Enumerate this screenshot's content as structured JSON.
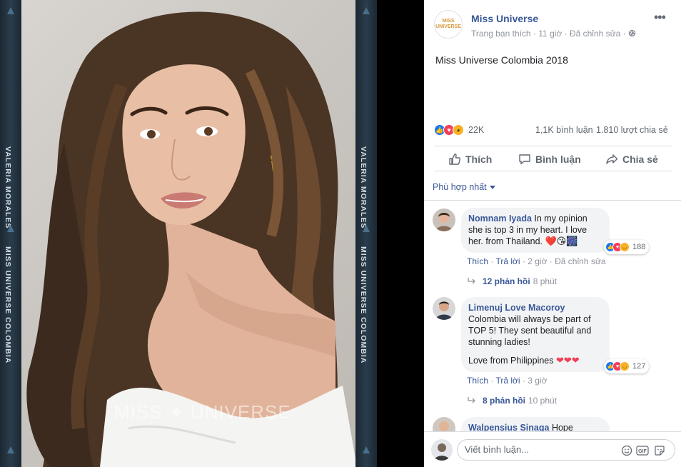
{
  "photo": {
    "left_strip_text_top": "VALERIA MORALES",
    "left_strip_text_bottom": "MISS UNIVERSE COLOMBIA",
    "right_strip_text_top": "VALERIA MORALES",
    "right_strip_text_bottom": "MISS UNIVERSE COLOMBIA",
    "watermark": "MISS ✦ UNIVERSE"
  },
  "post": {
    "page_logo_text": "MISS UNIVERSE",
    "page_name": "Miss Universe",
    "meta": "Trang bạn thích · 11 giờ · Đã chỉnh sửa ·",
    "text": "Miss Universe Colombia 2018",
    "reaction_count": "22K",
    "comments_count": "1,1K bình luận",
    "shares_count": "1.810 lượt chia sẻ"
  },
  "actions": {
    "like": "Thích",
    "comment": "Bình luận",
    "share": "Chia sẻ"
  },
  "sort_label": "Phù hợp nhất",
  "comments": [
    {
      "author": "Nomnam Iyada",
      "text": "In my opinion she is top 3 in my heart. I love her. from Thailand.",
      "emoji": "❤️😘🎆",
      "reactions": "188",
      "like": "Thích",
      "reply": "Trả lời",
      "time": "2 giờ",
      "edited": "Đã chỉnh sửa",
      "replies": "12 phản hồi",
      "replies_ago": "8 phút"
    },
    {
      "author": "Limenuj Love Macoroy",
      "text": "Colombia will always be part of TOP 5! They sent beautiful and stunning ladies!",
      "text2": "Love from Philippines",
      "emoji": "❤❤❤",
      "reactions": "127",
      "like": "Thích",
      "reply": "Trả lời",
      "time": "3 giờ",
      "replies": "8 phản hồi",
      "replies_ago": "10 phút"
    },
    {
      "author": "Walpensius Sinaga",
      "text": "Hope"
    }
  ],
  "composer": {
    "placeholder": "Viết bình luận..."
  },
  "colors": {
    "link": "#385898",
    "like_blue": "#1877f2",
    "love_red": "#f33e58"
  }
}
